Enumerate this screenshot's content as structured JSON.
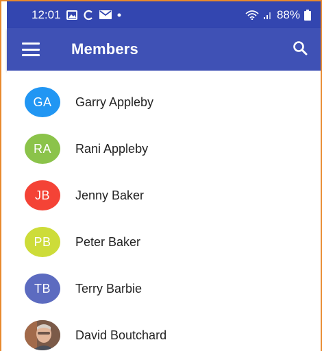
{
  "status_bar": {
    "time": "12:01",
    "battery": "88%",
    "icons": [
      "gallery-icon",
      "sync-icon",
      "mail-icon",
      "dot-icon",
      "wifi-icon",
      "signal-icon",
      "battery-icon"
    ]
  },
  "app_bar": {
    "title": "Members",
    "menu_icon": "menu-icon",
    "search_icon": "search-icon"
  },
  "members": [
    {
      "initials": "GA",
      "name": "Garry Appleby",
      "color": "#2196f3"
    },
    {
      "initials": "RA",
      "name": "Rani Appleby",
      "color": "#8bc34a"
    },
    {
      "initials": "JB",
      "name": "Jenny Baker",
      "color": "#f44336"
    },
    {
      "initials": "PB",
      "name": "Peter Baker",
      "color": "#cddc39"
    },
    {
      "initials": "TB",
      "name": "Terry Barbie",
      "color": "#5c6bc0"
    },
    {
      "initials": "",
      "name": "David Boutchard",
      "photo": true
    }
  ],
  "colors": {
    "status_bar": "#3346b0",
    "app_bar": "#3f51b5",
    "frame_border": "#e8892d"
  }
}
